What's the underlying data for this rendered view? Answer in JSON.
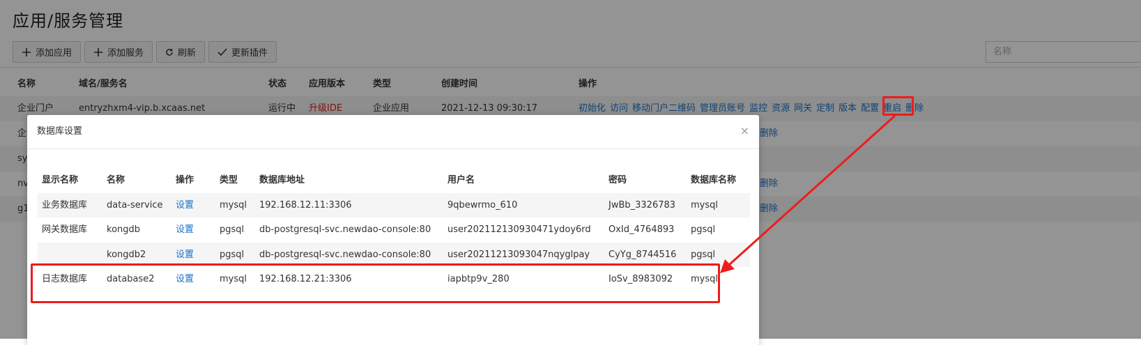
{
  "page": {
    "title": "应用/服务管理",
    "toolbar": {
      "add_app": "添加应用",
      "add_service": "添加服务",
      "refresh": "刷新",
      "update_plugin": "更新插件"
    },
    "search_placeholder": "名称",
    "table": {
      "headers": [
        "名称",
        "域名/服务名",
        "状态",
        "应用版本",
        "类型",
        "创建时间",
        "操作"
      ],
      "rows": [
        {
          "name": "企业门户",
          "domain": "entryzhxm4-vip.b.xcaas.net",
          "status": "运行中",
          "version": "升级IDE",
          "type": "企业应用",
          "created": "2021-12-13 09:30:17",
          "ops": [
            "初始化",
            "访问",
            "移动门户二维码",
            "管理员账号",
            "监控",
            "资源",
            "网关",
            "定制",
            "版本",
            "配置",
            "重启",
            "删除"
          ]
        },
        {
          "name": "企",
          "ops_tail": "删除"
        },
        {
          "name": "sy"
        },
        {
          "name": "nv",
          "ops_tail": "删除"
        },
        {
          "name": "g1",
          "ops_tail": "删除"
        }
      ]
    }
  },
  "modal": {
    "title": "数据库设置",
    "close": "×",
    "headers": [
      "显示名称",
      "名称",
      "操作",
      "类型",
      "数据库地址",
      "用户名",
      "密码",
      "数据库名称"
    ],
    "rows": [
      {
        "display": "业务数据库",
        "name": "data-service",
        "action": "设置",
        "type": "mysql",
        "address": "192.168.12.11:3306",
        "user": "9qbewrmo_610",
        "password": "JwBb_3326783",
        "dbname": "mysql"
      },
      {
        "display": "网关数据库",
        "name": "kongdb",
        "action": "设置",
        "type": "pgsql",
        "address": "db-postgresql-svc.newdao-console:80",
        "user": "user202112130930471ydoy6rd",
        "password": "OxId_4764893",
        "dbname": "pgsql"
      },
      {
        "display": "",
        "name": "kongdb2",
        "action": "设置",
        "type": "pgsql",
        "address": "db-postgresql-svc.newdao-console:80",
        "user": "user20211213093047nqyglpay",
        "password": "CyYg_8744516",
        "dbname": "pgsql"
      },
      {
        "display": "日志数据库",
        "name": "database2",
        "action": "设置",
        "type": "mysql",
        "address": "192.168.12.21:3306",
        "user": "iapbtp9v_280",
        "password": "IoSv_8983092",
        "dbname": "mysql"
      }
    ]
  },
  "colors": {
    "link": "#1a73c9",
    "annotation": "#ee1c1c",
    "upgrade": "#e02020"
  }
}
